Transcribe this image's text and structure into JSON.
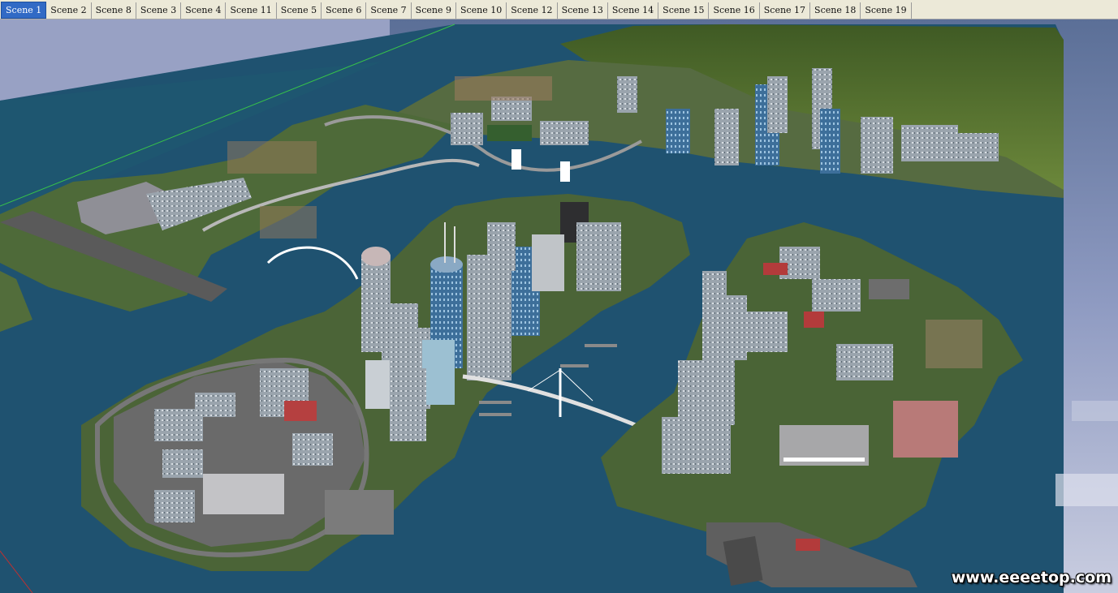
{
  "tabs": [
    {
      "label": "Scene 1",
      "active": true
    },
    {
      "label": "Scene 2",
      "active": false
    },
    {
      "label": "Scene 8",
      "active": false
    },
    {
      "label": "Scene 3",
      "active": false
    },
    {
      "label": "Scene 4",
      "active": false
    },
    {
      "label": "Scene 11",
      "active": false
    },
    {
      "label": "Scene 5",
      "active": false
    },
    {
      "label": "Scene 6",
      "active": false
    },
    {
      "label": "Scene 7",
      "active": false
    },
    {
      "label": "Scene 9",
      "active": false
    },
    {
      "label": "Scene 10",
      "active": false
    },
    {
      "label": "Scene 12",
      "active": false
    },
    {
      "label": "Scene 13",
      "active": false
    },
    {
      "label": "Scene 14",
      "active": false
    },
    {
      "label": "Scene 15",
      "active": false
    },
    {
      "label": "Scene 16",
      "active": false
    },
    {
      "label": "Scene 17",
      "active": false
    },
    {
      "label": "Scene 18",
      "active": false
    },
    {
      "label": "Scene 19",
      "active": false
    }
  ],
  "watermark": "www.eeeetop.com",
  "colors": {
    "water": "#1d4e6a",
    "land": "#4a5f3a",
    "road": "#555555",
    "sky": "#8d95b8",
    "tab_active": "#316ac5"
  }
}
